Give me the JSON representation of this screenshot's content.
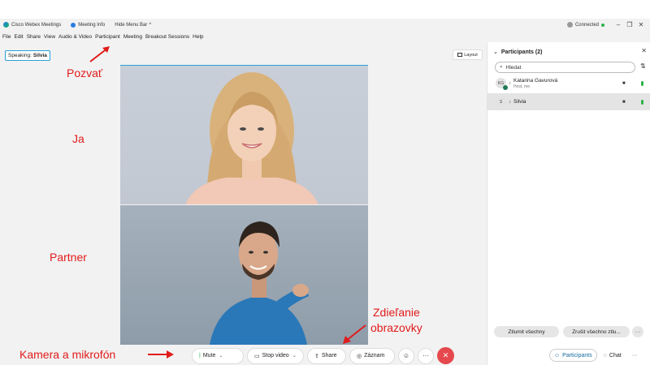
{
  "window": {
    "app_title": "Cisco Webex Meetings",
    "meeting_info": "Meeting Info",
    "hide_menu_bar": "Hide Menu Bar",
    "connection_status": "Connected",
    "controls": {
      "minimize": "–",
      "restore": "❐",
      "close": "✕"
    }
  },
  "menu": [
    "File",
    "Edit",
    "Share",
    "View",
    "Audio & Video",
    "Participant",
    "Meeting",
    "Breakout Sessions",
    "Help"
  ],
  "stage": {
    "speaking_label": "Speaking:",
    "speaking_name": "Silvia",
    "layout_label": "Layout"
  },
  "annotations": {
    "invite": "Pozvať",
    "me": "Ja",
    "partner": "Partner",
    "share_screen_line1": "Zdieľanie",
    "share_screen_line2": "obrazovky",
    "camera_mic": "Kamera a mikrofón",
    "color": "#e21b1b"
  },
  "toolbar": {
    "mute": "Mute",
    "stop_video": "Stop video",
    "share": "Share",
    "record": "Záznam",
    "more": "···",
    "end": "✕"
  },
  "participants_panel": {
    "title": "Participants (2)",
    "search_placeholder": "Hledat",
    "participants": [
      {
        "initials": "KG",
        "name": "Katarina Gavurová",
        "role": "Host, me",
        "selected": false
      },
      {
        "initials": "S",
        "name": "Silvia",
        "role": "",
        "selected": true
      }
    ],
    "mute_all": "Ztlumit všechny",
    "unmute_all": "Zrušit všechno ztlu...",
    "tabs": {
      "participants": "Participants",
      "chat": "Chat"
    }
  },
  "colors": {
    "accent": "#2a9fd6",
    "end_call": "#e5484d",
    "mic_green": "#2cb34a"
  }
}
